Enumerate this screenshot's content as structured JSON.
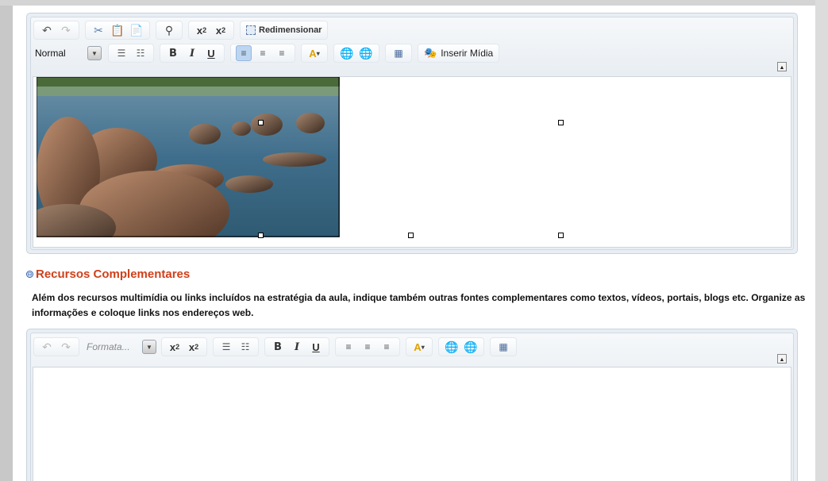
{
  "editor1": {
    "toolbar_row1": {
      "undo_icon": "undo-icon",
      "redo_icon": "redo-icon",
      "resize_label": "Redimensionar"
    },
    "toolbar_row2": {
      "format_value": "Normal",
      "insert_media_label": "Inserir Mídia"
    }
  },
  "section": {
    "toggle_symbol": "⊖",
    "title": "Recursos Complementares",
    "description": "Além dos recursos multimídia ou links incluídos na estratégia da aula, indique também outras fontes complementares como textos, vídeos, portais, blogs etc. Organize as informações e coloque links nos endereços web."
  },
  "editor2": {
    "format_placeholder": "Formata..."
  },
  "colors": {
    "title_color": "#d0401a",
    "active_button": "#bcd6f2"
  }
}
